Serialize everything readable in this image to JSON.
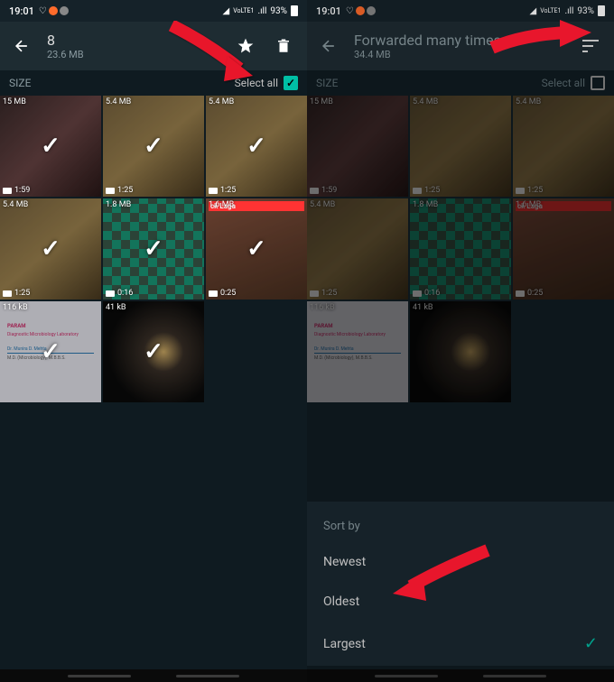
{
  "status": {
    "time": "19:01",
    "net_label": "VoLTE1",
    "signal_label": ".ıll",
    "battery_pct": "93%"
  },
  "left": {
    "title": "8",
    "subtitle": "23.6 MB",
    "size_label": "SIZE",
    "select_all": "Select all",
    "select_all_checked": true,
    "tiles": [
      {
        "size": "15 MB",
        "dur": "1:59",
        "sel": true,
        "bg": "bg-girl"
      },
      {
        "size": "5.4 MB",
        "dur": "1:25",
        "sel": true,
        "bg": "bg-market"
      },
      {
        "size": "5.4 MB",
        "dur": "1:25",
        "sel": true,
        "bg": "bg-market"
      },
      {
        "size": "5.4 MB",
        "dur": "1:25",
        "sel": true,
        "bg": "bg-market"
      },
      {
        "size": "1.8 MB",
        "dur": "0:16",
        "sel": true,
        "bg": "bg-pixel"
      },
      {
        "size": "1.6 MB",
        "dur": "0:25",
        "sel": true,
        "bg": "bg-photo",
        "banner": "ck Laga"
      },
      {
        "size": "116 kB",
        "dur": "",
        "sel": true,
        "bg": "bg-doc"
      },
      {
        "size": "41 kB",
        "dur": "",
        "sel": true,
        "bg": "bg-dark"
      }
    ]
  },
  "right": {
    "title": "Forwarded many times",
    "subtitle": "34.4 MB",
    "size_label": "SIZE",
    "select_all": "Select all",
    "select_all_checked": false,
    "tiles": [
      {
        "size": "15 MB",
        "dur": "1:59",
        "bg": "bg-girl"
      },
      {
        "size": "5.4 MB",
        "dur": "1:25",
        "bg": "bg-market"
      },
      {
        "size": "5.4 MB",
        "dur": "1:25",
        "bg": "bg-market"
      },
      {
        "size": "5.4 MB",
        "dur": "1:25",
        "bg": "bg-market"
      },
      {
        "size": "1.8 MB",
        "dur": "0:16",
        "bg": "bg-pixel"
      },
      {
        "size": "1.6 MB",
        "dur": "0:25",
        "bg": "bg-photo",
        "banner": "ck Laga"
      },
      {
        "size": "116 kB",
        "dur": "",
        "bg": "bg-doc"
      },
      {
        "size": "41 kB",
        "dur": "",
        "bg": "bg-dark"
      }
    ],
    "sort": {
      "title": "Sort by",
      "options": [
        {
          "label": "Newest",
          "sel": false
        },
        {
          "label": "Oldest",
          "sel": false
        },
        {
          "label": "Largest",
          "sel": true
        }
      ]
    }
  },
  "doc": {
    "brand": "PARAM",
    "lines": "Diagnostic Microbiology Laboratory",
    "name": "Dr. Munira D. Mehta",
    "cred": "M.D. (Microbiology), M.B.B.S."
  }
}
